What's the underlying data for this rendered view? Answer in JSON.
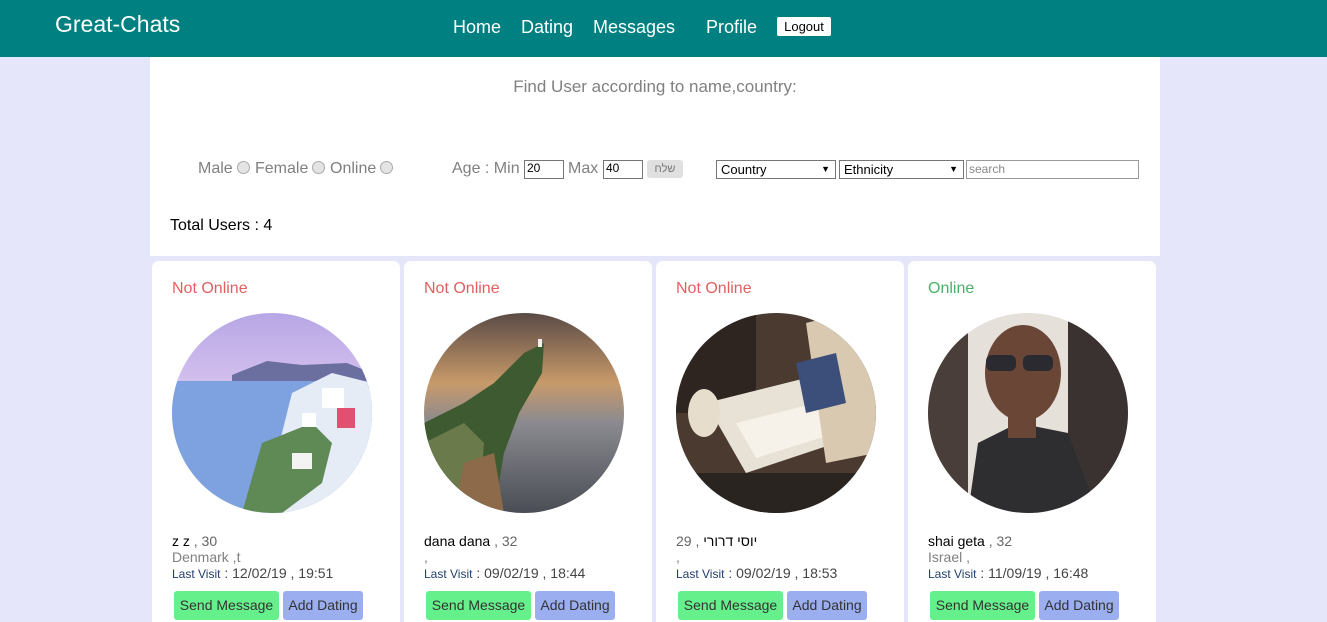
{
  "nav": {
    "brand": "Great-Chats",
    "home": "Home",
    "dating": "Dating",
    "messages": "Messages",
    "profile": "Profile",
    "logout": "Logout"
  },
  "search": {
    "title": "Find User according to name,country:",
    "male": "Male",
    "female": "Female",
    "online": "Online",
    "age_label": "Age : Min",
    "max_label": "Max",
    "min_value": "20",
    "max_value": "40",
    "send_label": "שלח",
    "country_selected": "Country",
    "ethnicity_selected": "Ethnicity",
    "search_placeholder": "search",
    "total_label": "Total Users : 4"
  },
  "users": [
    {
      "status": "Not Online",
      "name": "z z",
      "age": " , 30",
      "country": "Denmark ,t",
      "last_visit_label": "Last Visit",
      "last_visit": " : 12/02/19 , 19:51",
      "send_message": "Send Message",
      "add_dating": "Add Dating",
      "status_color": "#e06060",
      "image": "santorini-coast-photo"
    },
    {
      "status": "Not Online",
      "name": "dana dana",
      "age": " , 32",
      "country": ",",
      "last_visit_label": "Last Visit",
      "last_visit": " : 09/02/19 , 18:44",
      "send_message": "Send Message",
      "add_dating": "Add Dating",
      "status_color": "#e06060",
      "image": "sea-cliff-lighthouse-photo"
    },
    {
      "status": "Not Online",
      "name": "יוסי דרורי",
      "age": "29 , ",
      "country": ",",
      "last_visit_label": "Last Visit",
      "last_visit": " : 09/02/19 , 18:53",
      "send_message": "Send Message",
      "add_dating": "Add Dating",
      "status_color": "#e06060",
      "image": "cafe-notebook-photo"
    },
    {
      "status": "Online",
      "name": "shai geta",
      "age": " , 32",
      "country": "Israel ,",
      "last_visit_label": "Last Visit",
      "last_visit": " : 11/09/19 , 16:48",
      "send_message": "Send Message",
      "add_dating": "Add Dating",
      "status_color": "#4caf68",
      "image": "man-sunglasses-photo"
    }
  ]
}
